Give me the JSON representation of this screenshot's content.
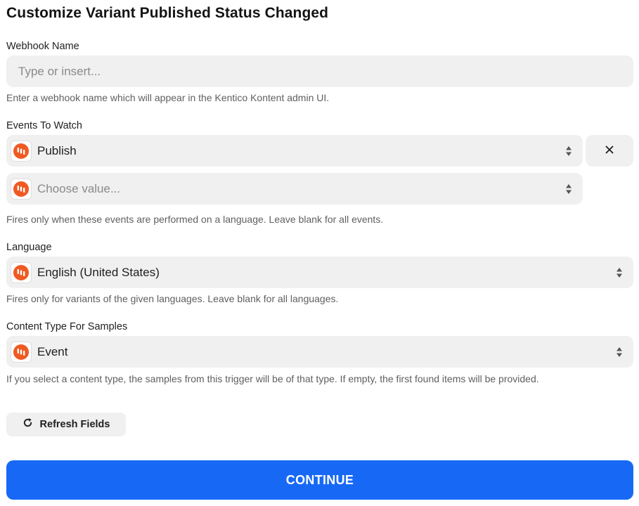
{
  "page": {
    "title": "Customize Variant Published Status Changed"
  },
  "webhook_name": {
    "label": "Webhook Name",
    "placeholder": "Type or insert...",
    "help": "Enter a webhook name which will appear in the Kentico Kontent admin UI."
  },
  "events_to_watch": {
    "label": "Events To Watch",
    "selected_value": "Publish",
    "empty_placeholder": "Choose value...",
    "help": "Fires only when these events are performed on a language. Leave blank for all events."
  },
  "language": {
    "label": "Language",
    "selected_value": "English (United States)",
    "help": "Fires only for variants of the given languages. Leave blank for all languages."
  },
  "content_type": {
    "label": "Content Type For Samples",
    "selected_value": "Event",
    "help": "If you select a content type, the samples from this trigger will be of that type. If empty, the first found items will be provided."
  },
  "buttons": {
    "refresh_label": "Refresh Fields",
    "continue_label": "CONTINUE"
  },
  "icons": {
    "app": "kentico-kontent-app-icon",
    "select": "sort-arrows-icon",
    "remove": "close-icon",
    "refresh": "refresh-icon"
  },
  "colors": {
    "primary": "#1769f5",
    "app_icon": "#f05a22",
    "field_background": "#f0f0f0"
  }
}
